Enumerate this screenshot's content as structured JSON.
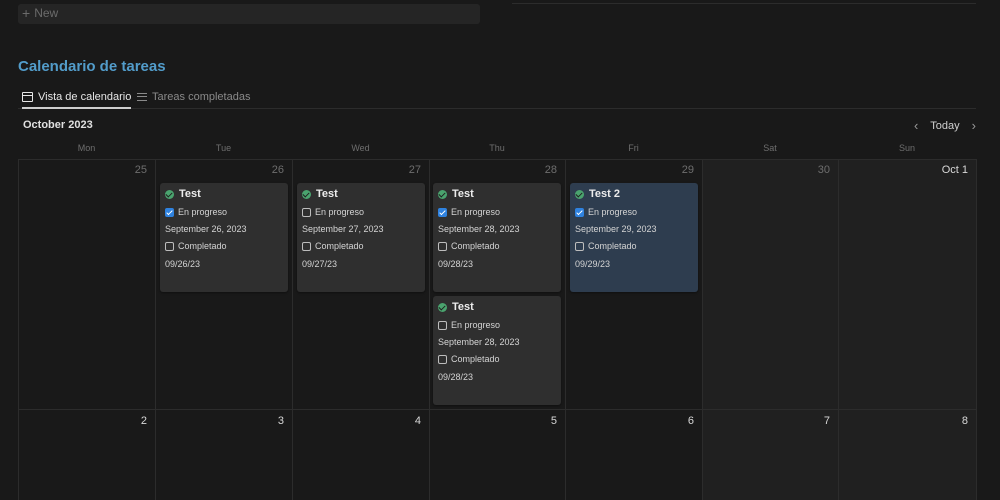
{
  "top": {
    "new_label": "New"
  },
  "title": "Calendario de tareas",
  "tabs": [
    {
      "label": "Vista de calendario",
      "icon": "calendar-icon",
      "active": true
    },
    {
      "label": "Tareas completadas",
      "icon": "list-icon",
      "active": false
    }
  ],
  "month_label": "October 2023",
  "nav": {
    "prev": "‹",
    "today": "Today",
    "next": "›"
  },
  "weekdays": [
    "Mon",
    "Tue",
    "Wed",
    "Thu",
    "Fri",
    "Sat",
    "Sun"
  ],
  "week1": [
    "25",
    "26",
    "27",
    "28",
    "29",
    "30",
    "Oct 1"
  ],
  "week2": [
    "2",
    "3",
    "4",
    "5",
    "6",
    "7",
    "8"
  ],
  "colors": {
    "accent_title": "#529cca",
    "checkbox_on": "#2f82df",
    "status_dot": "#4aa36e",
    "selected_card": "#2e3d4f"
  },
  "cards": [
    {
      "title": "Test",
      "prop_label": "En progreso",
      "prop_checked": true,
      "date": "September 26, 2023",
      "done_label": "Completado",
      "done_checked": false,
      "short_date": "09/26/23"
    },
    {
      "title": "Test",
      "prop_label": "En progreso",
      "prop_checked": false,
      "date": "September 27, 2023",
      "done_label": "Completado",
      "done_checked": false,
      "short_date": "09/27/23"
    },
    {
      "title": "Test",
      "prop_label": "En progreso",
      "prop_checked": true,
      "date": "September 28, 2023",
      "done_label": "Completado",
      "done_checked": false,
      "short_date": "09/28/23"
    },
    {
      "title": "Test 2",
      "prop_label": "En progreso",
      "prop_checked": true,
      "date": "September 29, 2023",
      "done_label": "Completado",
      "done_checked": false,
      "short_date": "09/29/23",
      "selected": true
    },
    {
      "title": "Test",
      "prop_label": "En progreso",
      "prop_checked": false,
      "date": "September 28, 2023",
      "done_label": "Completado",
      "done_checked": false,
      "short_date": "09/28/23"
    }
  ]
}
